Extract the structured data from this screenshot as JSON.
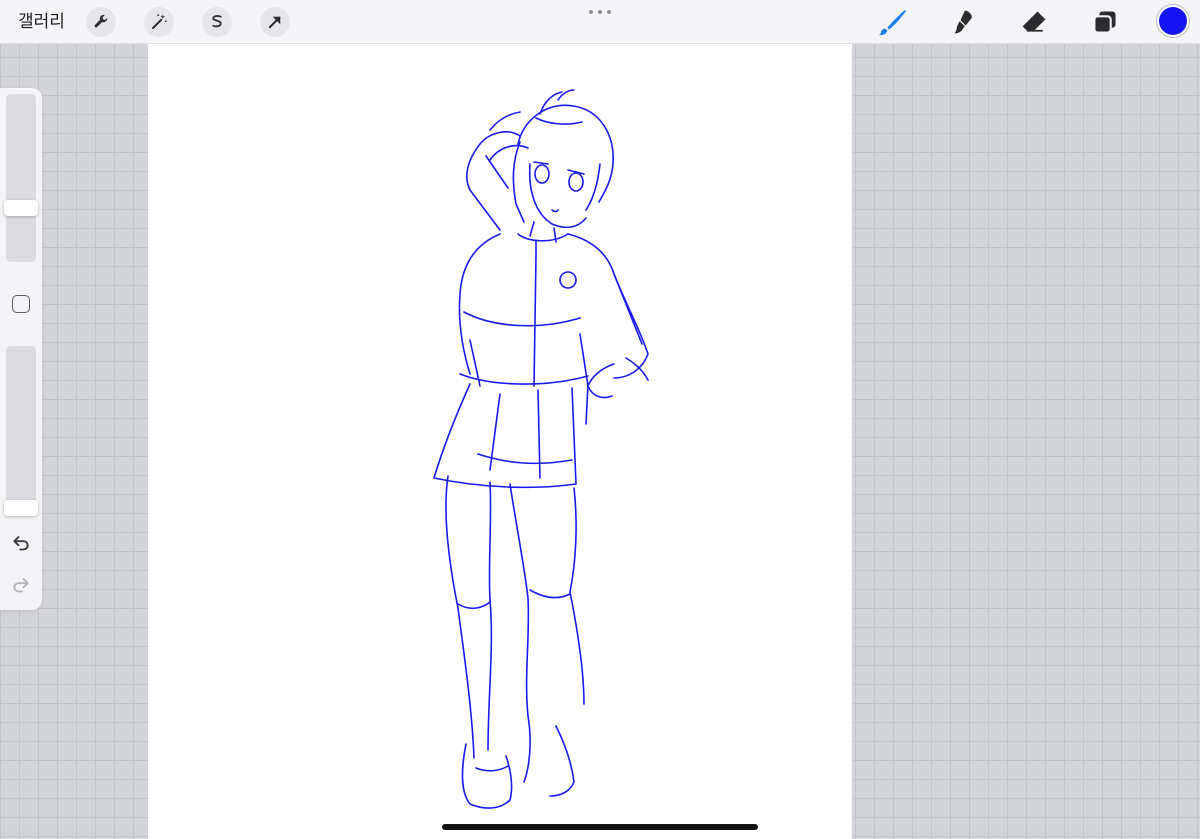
{
  "toolbar": {
    "gallery_label": "갤러리",
    "left_tools": [
      "wrench-icon",
      "magic-wand-icon",
      "selection-icon",
      "transform-arrow-icon"
    ],
    "right_tools": [
      "brush-icon",
      "smudge-icon",
      "eraser-icon",
      "layers-icon"
    ],
    "active_tool": "brush-icon",
    "active_tool_color": "#1e7ef0",
    "current_color": "#1414f5"
  },
  "sidebar": {
    "brush_size_level": 0.3,
    "opacity_level": 0.0,
    "controls": [
      "brush-size-slider",
      "modify-square",
      "opacity-slider",
      "undo-icon",
      "redo-icon"
    ]
  },
  "canvas": {
    "background": "#ffffff",
    "stroke_color": "#1a1aee",
    "subject": "figure-sketch"
  }
}
